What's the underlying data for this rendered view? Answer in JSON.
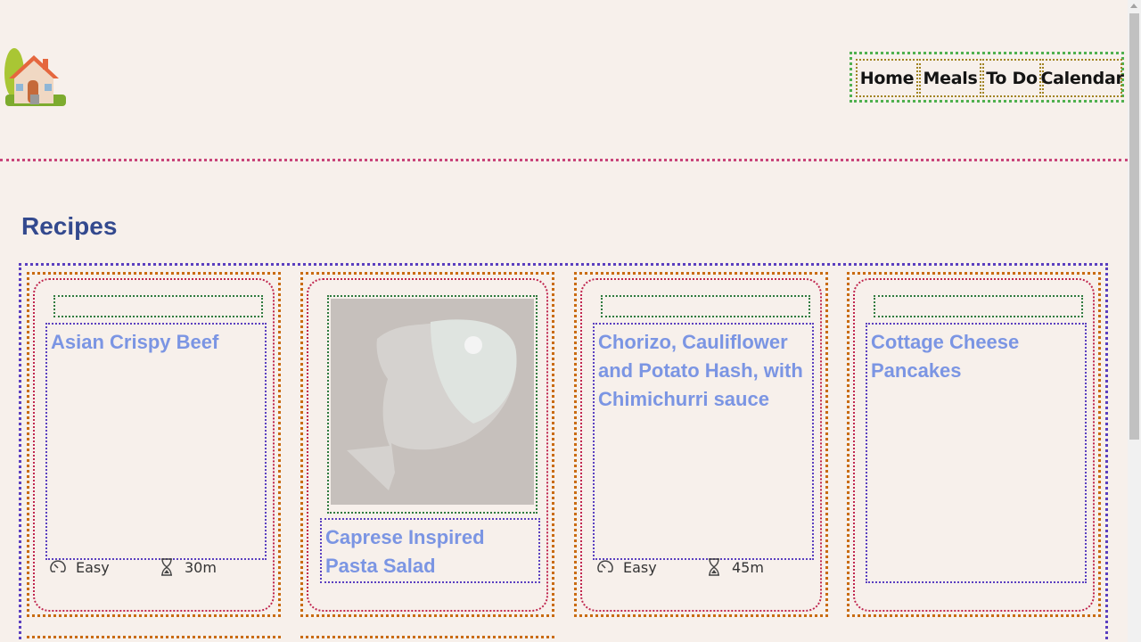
{
  "nav": {
    "items": [
      {
        "label": "Home"
      },
      {
        "label": "Meals"
      },
      {
        "label": "To Do"
      },
      {
        "label": "Calendar"
      }
    ]
  },
  "page": {
    "title": "Recipes"
  },
  "recipes": [
    {
      "title": "Asian Crispy Beef",
      "difficulty": "Easy",
      "time": "30m",
      "has_image": false
    },
    {
      "title": "Caprese Inspired Pasta Salad",
      "has_image": true,
      "image_icon": "fish-placeholder-icon"
    },
    {
      "title": "Chorizo, Cauliflower and Potato Hash, with Chimichurri sauce",
      "difficulty": "Easy",
      "time": "45m",
      "has_image": false
    },
    {
      "title": "Cottage Cheese Pancakes",
      "has_image": false
    }
  ],
  "icons": {
    "logo": "house-logo-icon",
    "difficulty": "gauge-icon",
    "time": "hourglass-icon"
  },
  "colors": {
    "background": "#f7f0eb",
    "title": "#33498e",
    "card_title": "#7b95e3"
  }
}
